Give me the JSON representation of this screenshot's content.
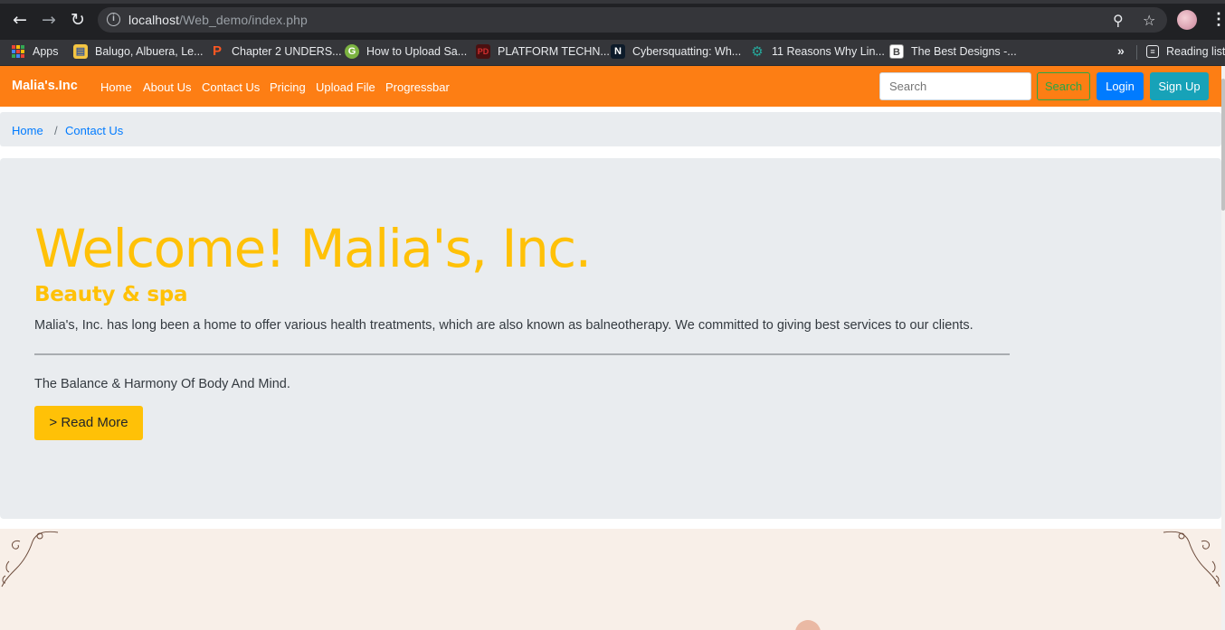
{
  "browser": {
    "url_host": "localhost",
    "url_path": "/Web_demo/index.php",
    "bookmarks": [
      {
        "label": "Apps",
        "icon": "apps-grid-icon"
      },
      {
        "label": "Balugo, Albuera, Le...",
        "icon": "building-icon"
      },
      {
        "label": "Chapter 2 UNDERS...",
        "icon": "p-logo-icon"
      },
      {
        "label": "How to Upload Sa...",
        "icon": "green-logo-icon"
      },
      {
        "label": "PLATFORM TECHN...",
        "icon": "pd-logo-icon"
      },
      {
        "label": "Cybersquatting: Wh...",
        "icon": "n-logo-icon"
      },
      {
        "label": "11 Reasons Why Lin...",
        "icon": "gear-logo-icon"
      },
      {
        "label": "The Best Designs -...",
        "icon": "b-logo-icon"
      }
    ],
    "reading_list": "Reading list"
  },
  "navbar": {
    "brand": "Malia's.Inc",
    "links": [
      "Home",
      "About Us",
      "Contact Us",
      "Pricing",
      "Upload File",
      "Progressbar"
    ],
    "search_placeholder": "Search",
    "search_button": "Search",
    "login_button": "Login",
    "signup_button": "Sign Up"
  },
  "breadcrumb": {
    "items": [
      "Home",
      "Contact Us"
    ],
    "separator": "/"
  },
  "hero": {
    "title": "Welcome! Malia's, Inc.",
    "subtitle": "Beauty & spa",
    "lead": "Malia's, Inc. has long been a home to offer various health treatments, which are also known as balneotherapy. We committed to giving best services to our clients.",
    "tagline": "The Balance & Harmony Of Body And Mind.",
    "read_more": "> Read More"
  },
  "colors": {
    "navbar": "#fd7e14",
    "accent": "#ffc107",
    "login": "#007bff",
    "signup": "#17a2b8",
    "search_outline": "#28a745",
    "section_bg": "#f8efe8"
  }
}
